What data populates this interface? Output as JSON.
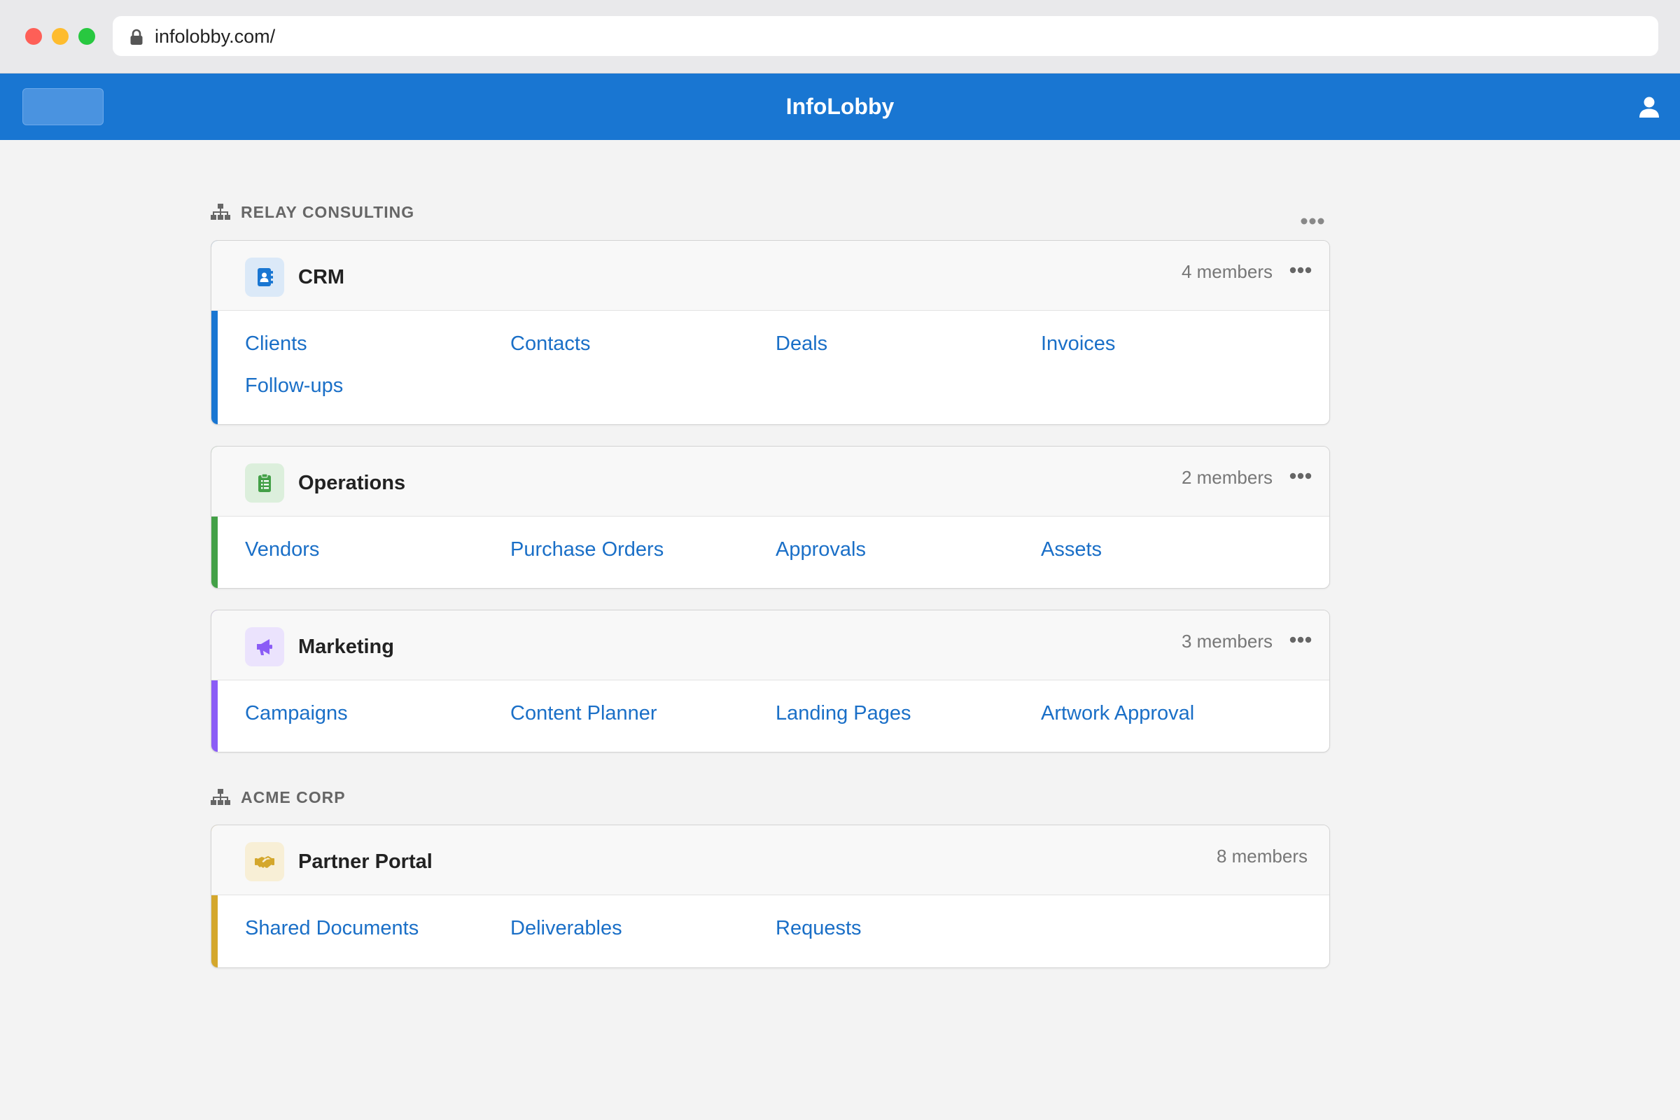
{
  "browser": {
    "url": "infolobby.com/"
  },
  "header": {
    "title": "InfoLobby",
    "brand_color": "#1976d2"
  },
  "icons": {
    "lock": "lock-icon",
    "user": "user-icon",
    "org": "org-chart-icon",
    "more": "more-horizontal-icon"
  },
  "groups": [
    {
      "name": "RELAY CONSULTING",
      "apps": [
        {
          "name": "CRM",
          "members": "4 members",
          "icon": "address-book-icon",
          "accent": "#1976d2",
          "links": [
            "Clients",
            "Contacts",
            "Deals",
            "Invoices",
            "Follow-ups"
          ]
        },
        {
          "name": "Operations",
          "members": "2 members",
          "icon": "clipboard-list-icon",
          "accent": "#43a047",
          "links": [
            "Vendors",
            "Purchase Orders",
            "Approvals",
            "Assets"
          ]
        },
        {
          "name": "Marketing",
          "members": "3 members",
          "icon": "megaphone-icon",
          "accent": "#8b5cf6",
          "links": [
            "Campaigns",
            "Content Planner",
            "Landing Pages",
            "Artwork Approval"
          ]
        }
      ]
    },
    {
      "name": "ACME CORP",
      "apps": [
        {
          "name": "Partner Portal",
          "members": "8 members",
          "icon": "handshake-icon",
          "accent": "#d4a72c",
          "links": [
            "Shared Documents",
            "Deliverables",
            "Requests"
          ]
        }
      ]
    }
  ]
}
